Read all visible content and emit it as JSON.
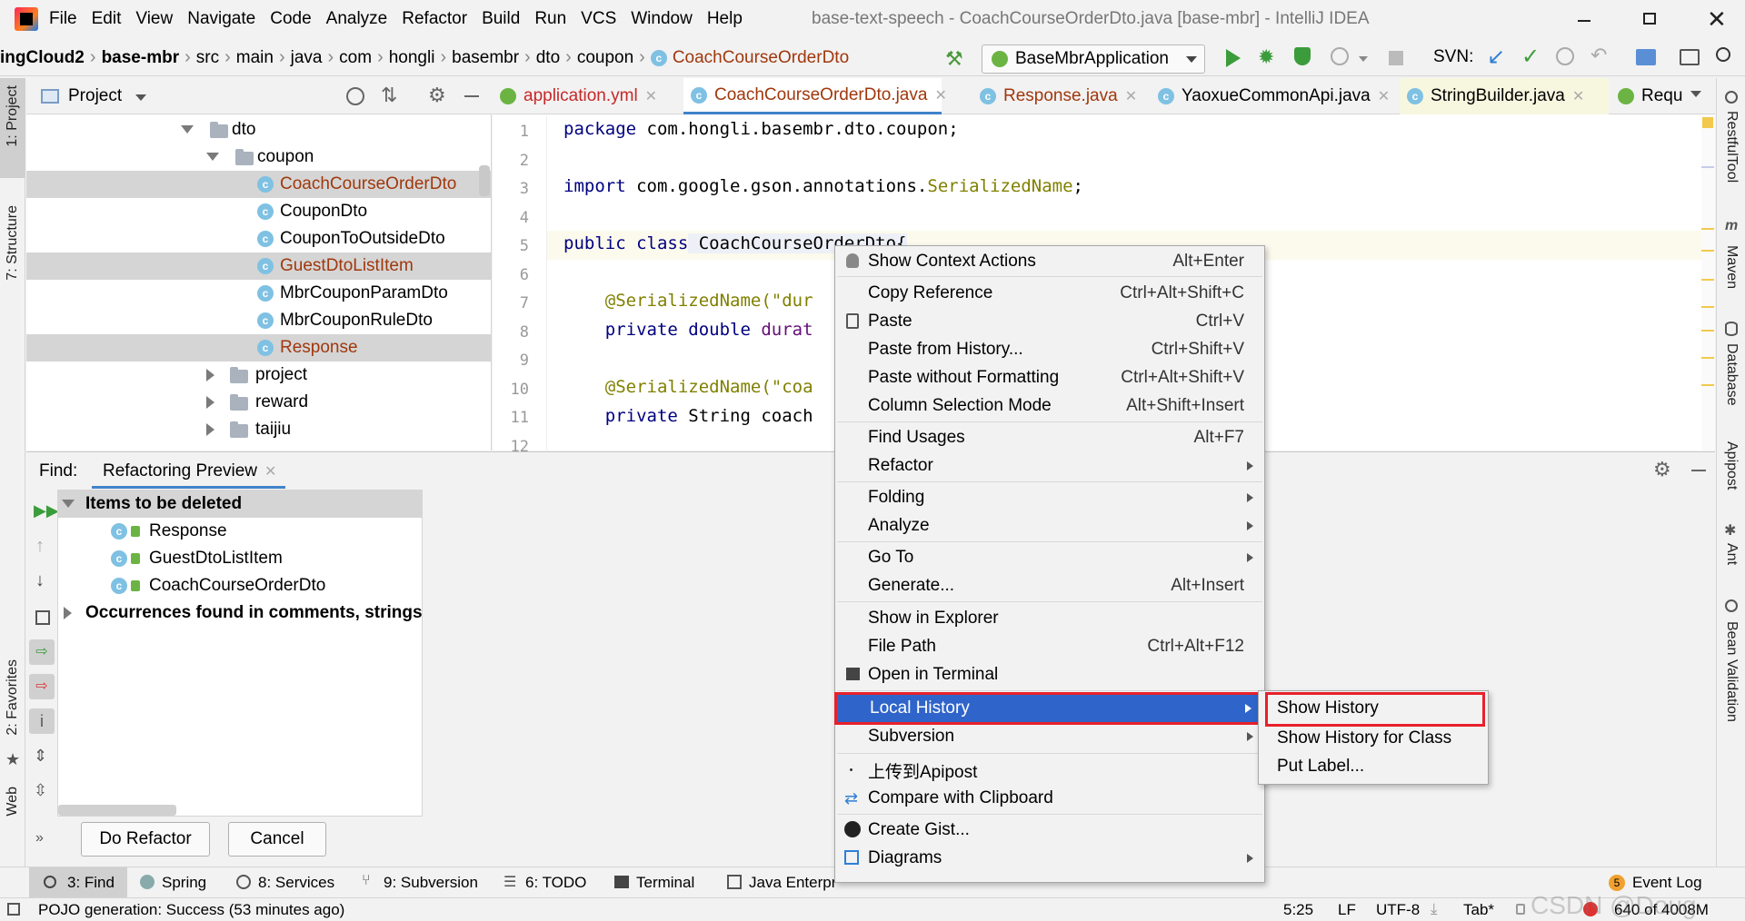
{
  "menubar": {
    "items": [
      "File",
      "Edit",
      "View",
      "Navigate",
      "Code",
      "Analyze",
      "Refactor",
      "Build",
      "Run",
      "VCS",
      "Window",
      "Help"
    ],
    "title": "base-text-speech - CoachCourseOrderDto.java [base-mbr] - IntelliJ IDEA"
  },
  "breadcrumb": {
    "items": [
      "ingCloud2",
      "base-mbr",
      "src",
      "main",
      "java",
      "com",
      "hongli",
      "basembr",
      "dto",
      "coupon",
      "CoachCourseOrderDto"
    ]
  },
  "toolbar": {
    "run_config": "BaseMbrApplication",
    "svn_label": "SVN:"
  },
  "project_panel": {
    "title": "Project",
    "tree": [
      {
        "label": "dto",
        "type": "folder",
        "expanded": true
      },
      {
        "label": "coupon",
        "type": "folder",
        "expanded": true
      },
      {
        "label": "CoachCourseOrderDto",
        "type": "class",
        "highlight": true
      },
      {
        "label": "CouponDto",
        "type": "class"
      },
      {
        "label": "CouponToOutsideDto",
        "type": "class"
      },
      {
        "label": "GuestDtoListItem",
        "type": "class",
        "highlight": true
      },
      {
        "label": "MbrCouponParamDto",
        "type": "class"
      },
      {
        "label": "MbrCouponRuleDto",
        "type": "class"
      },
      {
        "label": "Response",
        "type": "class",
        "highlight": true
      },
      {
        "label": "project",
        "type": "folder"
      },
      {
        "label": "reward",
        "type": "folder"
      },
      {
        "label": "taijiu",
        "type": "folder"
      }
    ]
  },
  "editor": {
    "tabs": [
      "application.yml",
      "CoachCourseOrderDto.java",
      "Response.java",
      "YaoxueCommonApi.java",
      "StringBuilder.java",
      "Requ"
    ],
    "lines": [
      "1",
      "2",
      "3",
      "4",
      "5",
      "6",
      "7",
      "8",
      "9",
      "10",
      "11",
      "12"
    ],
    "code": {
      "l1a": "package",
      "l1b": " com.hongli.basembr.dto.coupon;",
      "l3a": "import",
      "l3b": " com.google.gson.annotations.",
      "l3c": "SerializedName",
      "l3d": ";",
      "l5a": "public class",
      "l5b": " CoachCourseOrderDto{",
      "l7a": "    @SerializedName(\"dur",
      "l8a": "    private double",
      "l8b": " durat",
      "l10a": "    @SerializedName(\"coa",
      "l11a": "    private",
      "l11b": " String coach"
    }
  },
  "find_panel": {
    "label": "Find:",
    "tab": "Refactoring Preview",
    "group1": "Items to be deleted",
    "items": [
      "Response",
      "GuestDtoListItem",
      "CoachCourseOrderDto"
    ],
    "group2": "Occurrences found in comments, strings",
    "do_refactor": "Do Refactor",
    "cancel": "Cancel"
  },
  "context_menu": {
    "items": [
      {
        "label": "Show Context Actions",
        "shortcut": "Alt+Enter"
      },
      {
        "label": "Copy Reference",
        "shortcut": "Ctrl+Alt+Shift+C"
      },
      {
        "label": "Paste",
        "shortcut": "Ctrl+V"
      },
      {
        "label": "Paste from History...",
        "shortcut": "Ctrl+Shift+V"
      },
      {
        "label": "Paste without Formatting",
        "shortcut": "Ctrl+Alt+Shift+V"
      },
      {
        "label": "Column Selection Mode",
        "shortcut": "Alt+Shift+Insert"
      },
      {
        "label": "Find Usages",
        "shortcut": "Alt+F7"
      },
      {
        "label": "Refactor",
        "shortcut": ""
      },
      {
        "label": "Folding",
        "shortcut": ""
      },
      {
        "label": "Analyze",
        "shortcut": ""
      },
      {
        "label": "Go To",
        "shortcut": ""
      },
      {
        "label": "Generate...",
        "shortcut": "Alt+Insert"
      },
      {
        "label": "Show in Explorer",
        "shortcut": ""
      },
      {
        "label": "File Path",
        "shortcut": "Ctrl+Alt+F12"
      },
      {
        "label": "Open in Terminal",
        "shortcut": ""
      },
      {
        "label": "Local History",
        "shortcut": ""
      },
      {
        "label": "Subversion",
        "shortcut": ""
      },
      {
        "label": "上传到Apipost",
        "shortcut": ""
      },
      {
        "label": "Compare with Clipboard",
        "shortcut": ""
      },
      {
        "label": "Create Gist...",
        "shortcut": ""
      },
      {
        "label": "Diagrams",
        "shortcut": ""
      }
    ]
  },
  "submenu": {
    "items": [
      "Show History",
      "Show History for Class",
      "Put Label..."
    ]
  },
  "left_strip": [
    "1: Project",
    "7: Structure",
    "2: Favorites",
    "Web"
  ],
  "right_strip": [
    "RestfulTool",
    "Maven",
    "Database",
    "Apipost",
    "Ant",
    "Bean Validation"
  ],
  "bottom_tabs": [
    "3: Find",
    "Spring",
    "8: Services",
    "9: Subversion",
    "6: TODO",
    "Terminal",
    "Java Enterpr"
  ],
  "event_log": {
    "count": "5",
    "label": "Event Log"
  },
  "status": {
    "message": "POJO generation: Success (53 minutes ago)",
    "position": "5:25",
    "line_sep": "LF",
    "encoding": "UTF-8",
    "indent": "Tab*",
    "memory": "640 of 4008M",
    "watermark": "CSDN @Doug"
  },
  "colors": {
    "accent": "#2f65ca",
    "highlight_red": "#e8202a",
    "modified": "#a0380d"
  }
}
